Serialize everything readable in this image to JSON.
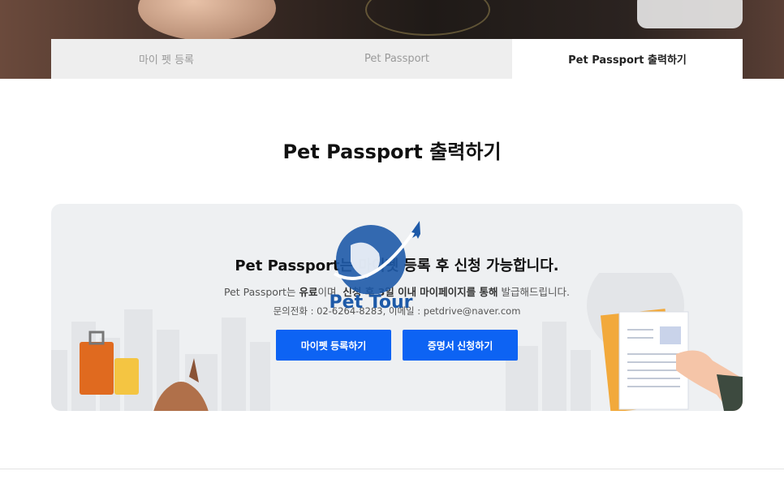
{
  "tabs": [
    {
      "label": "마이 펫 등록"
    },
    {
      "label": "Pet Passport"
    },
    {
      "label": "Pet Passport 출력하기"
    }
  ],
  "page_title": "Pet Passport 출력하기",
  "notice": {
    "headline": "Pet Passport는 마이펫 등록 후 신청 가능합니다.",
    "desc_prefix": "Pet Passport는 ",
    "desc_paid": "유료",
    "desc_mid1": "이며, ",
    "desc_after": "신청 후 3일 이내",
    "desc_mid2": " ",
    "desc_mypage": "마이페이지를 통해",
    "desc_suffix": " 발급해드립니다.",
    "contact": "문의전화 : 02-6264-8283, 이메일 : petdrive@naver.com"
  },
  "buttons": {
    "register": "마이펫 등록하기",
    "apply": "증명서 신청하기"
  },
  "logo": {
    "text": "Pet Tour"
  },
  "colors": {
    "accent": "#0d63f3",
    "logo": "#1e5aa8"
  }
}
